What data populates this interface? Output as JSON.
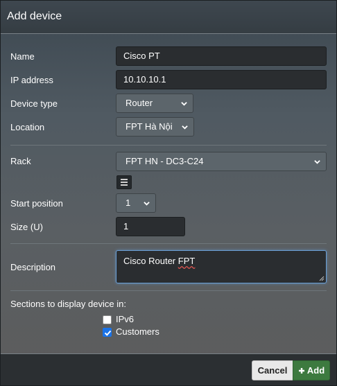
{
  "dialog": {
    "title": "Add device"
  },
  "form": {
    "name_label": "Name",
    "name_value": "Cisco PT",
    "ip_label": "IP address",
    "ip_value": "10.10.10.1",
    "device_type_label": "Device type",
    "device_type_value": "Router",
    "location_label": "Location",
    "location_value": "FPT Hà Nội",
    "rack_label": "Rack",
    "rack_value": "FPT HN - DC3-C24",
    "rack_button_icon": "list-icon",
    "start_position_label": "Start position",
    "start_position_value": "1",
    "size_label": "Size (U)",
    "size_value": "1",
    "description_label": "Description",
    "description_word1": "Cisco Router",
    "description_word2": "FPT",
    "sections_label": "Sections to display device in:",
    "sections": [
      {
        "label": "IPv6",
        "checked": false
      },
      {
        "label": "Customers",
        "checked": true
      }
    ]
  },
  "footer": {
    "cancel_label": "Cancel",
    "add_label": "Add",
    "add_icon": "plus-icon"
  },
  "colors": {
    "add_button": "#3d7a3f",
    "checkbox_checked": "#1a73e8",
    "focus_border": "#6aa0d8"
  }
}
